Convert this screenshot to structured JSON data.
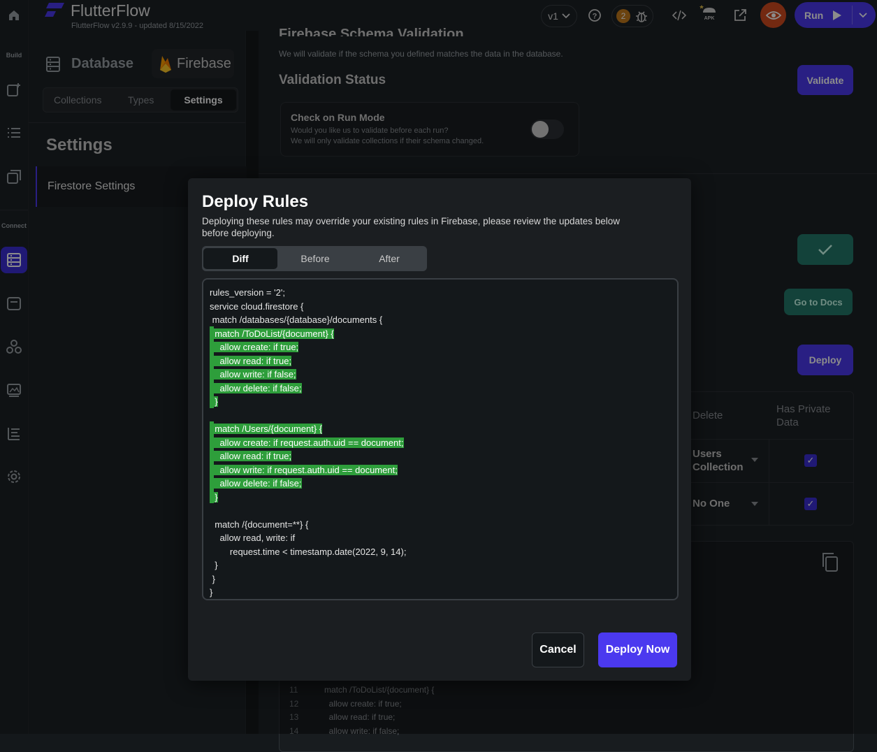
{
  "app": {
    "name": "FlutterFlow",
    "version_text": "FlutterFlow v2.9.9 - updated 8/15/2022",
    "version_select": "v1",
    "notification_count": "2",
    "run_label": "Run"
  },
  "rail": {
    "build_label": "Build",
    "connect_label": "Connect"
  },
  "panel": {
    "db_title": "Database",
    "firebase_label": "Firebase",
    "tabs": [
      "Collections",
      "Types",
      "Settings"
    ],
    "section_title": "Settings",
    "item": "Firestore Settings"
  },
  "main": {
    "schema_title": "Firebase Schema Validation",
    "schema_desc": "We will validate if the schema you defined matches the data in the database.",
    "validation_status": "Validation Status",
    "validate_label": "Validate",
    "check_title": "Check on Run Mode",
    "check_desc1": "Would you like us to validate before each run?",
    "check_desc2": "We will only validate collections if their schema changed.",
    "go_docs": "Go to Docs",
    "deploy": "Deploy",
    "col_delete": "Delete",
    "col_private": "Has Private Data",
    "row1_delete": "Users Collection",
    "row2_delete": "No One",
    "bg_code_lines": [
      {
        "n": "11",
        "t": "match /ToDoList/{document} {"
      },
      {
        "n": "12",
        "t": "  allow create: if true;"
      },
      {
        "n": "13",
        "t": "  allow read: if true;"
      },
      {
        "n": "14",
        "t": "  allow write: if false;"
      }
    ]
  },
  "dialog": {
    "title": "Deploy Rules",
    "desc": "Deploying these rules may override your existing rules in Firebase, please review the updates below before deploying.",
    "tabs": [
      "Diff",
      "Before",
      "After"
    ],
    "code": [
      {
        "t": "rules_version = '2';",
        "hl": false
      },
      {
        "t": "service cloud.firestore {",
        "hl": false
      },
      {
        "t": " match /databases/{database}/documents {",
        "hl": false
      },
      {
        "t": "  match /ToDoList/{document} {",
        "hl": true
      },
      {
        "t": "    allow create: if true;",
        "hl": true
      },
      {
        "t": "    allow read: if true;",
        "hl": true
      },
      {
        "t": "    allow write: if false;",
        "hl": true
      },
      {
        "t": "    allow delete: if false;",
        "hl": true
      },
      {
        "t": "  }",
        "hl": true
      },
      {
        "t": "",
        "hl": false
      },
      {
        "t": "  match /Users/{document} {",
        "hl": true
      },
      {
        "t": "    allow create: if request.auth.uid == document;",
        "hl": true
      },
      {
        "t": "    allow read: if true;",
        "hl": true
      },
      {
        "t": "    allow write: if request.auth.uid == document;",
        "hl": true
      },
      {
        "t": "    allow delete: if false;",
        "hl": true
      },
      {
        "t": "  }",
        "hl": true
      },
      {
        "t": "",
        "hl": false
      },
      {
        "t": "  match /{document=**} {",
        "hl": false
      },
      {
        "t": "    allow read, write: if",
        "hl": false
      },
      {
        "t": "        request.time < timestamp.date(2022, 9, 14);",
        "hl": false
      },
      {
        "t": "  }",
        "hl": false
      },
      {
        "t": " }",
        "hl": false
      },
      {
        "t": "}",
        "hl": false
      }
    ],
    "cancel": "Cancel",
    "deploy_now": "Deploy Now"
  }
}
